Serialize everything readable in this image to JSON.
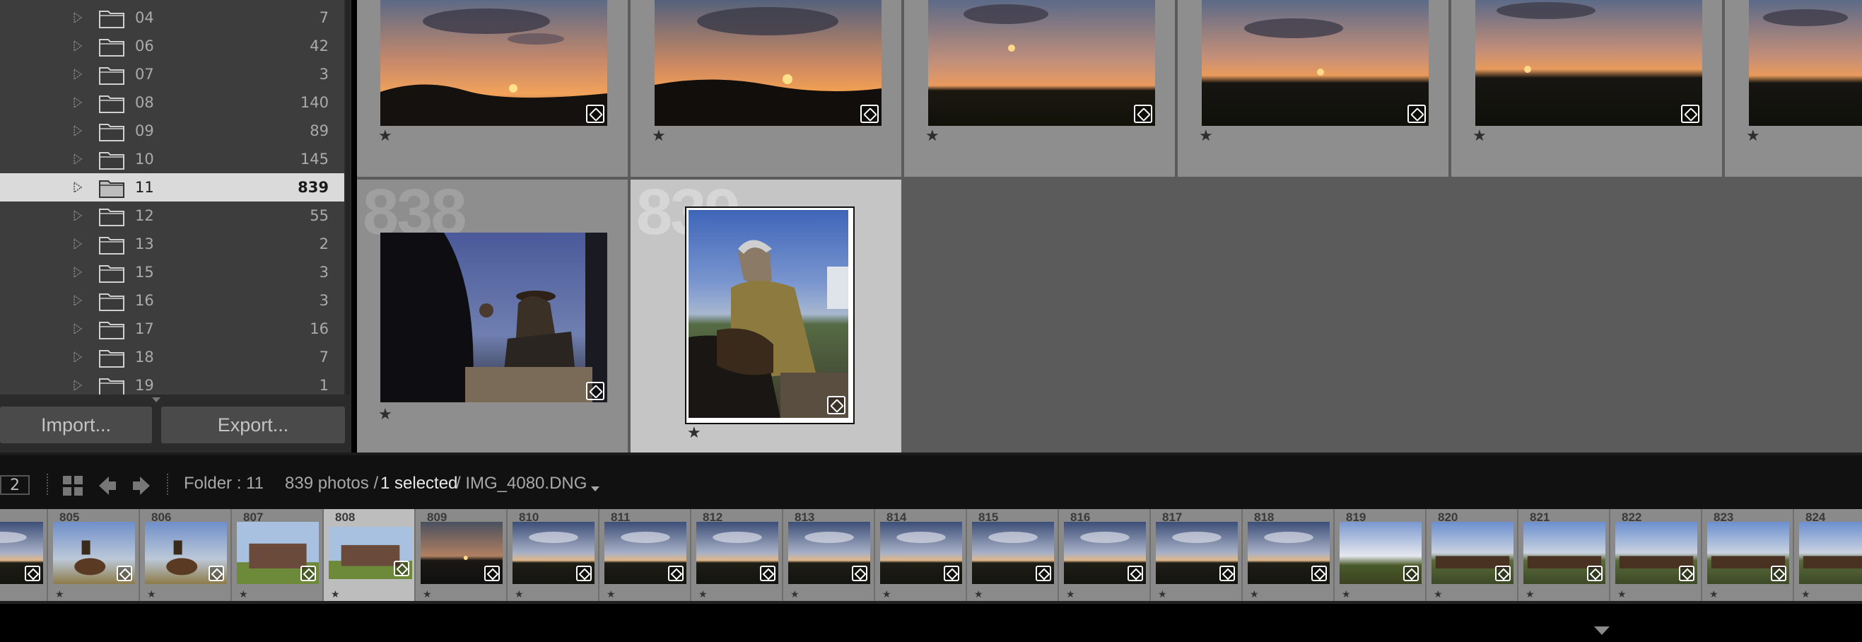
{
  "folders": [
    {
      "name": "04",
      "count": "7"
    },
    {
      "name": "06",
      "count": "42"
    },
    {
      "name": "07",
      "count": "3"
    },
    {
      "name": "08",
      "count": "140"
    },
    {
      "name": "09",
      "count": "89"
    },
    {
      "name": "10",
      "count": "145"
    },
    {
      "name": "11",
      "count": "839",
      "selected": true
    },
    {
      "name": "12",
      "count": "55"
    },
    {
      "name": "13",
      "count": "2"
    },
    {
      "name": "15",
      "count": "3"
    },
    {
      "name": "16",
      "count": "3"
    },
    {
      "name": "17",
      "count": "16"
    },
    {
      "name": "18",
      "count": "7"
    },
    {
      "name": "19",
      "count": "1"
    }
  ],
  "buttons": {
    "import": "Import...",
    "export": "Export..."
  },
  "grid": {
    "cells": [
      {
        "index": "838",
        "type": "people-dusk"
      },
      {
        "index": "839",
        "type": "man-dog",
        "selected": true
      }
    ]
  },
  "toolbar": {
    "page": "2",
    "folder": "Folder : 11",
    "photos_count": "839 photos /",
    "selected": "1 selected",
    "filename": "/ IMG_4080.DNG"
  },
  "filmstrip": [
    {
      "num": ""
    },
    {
      "num": "805",
      "type": "rider"
    },
    {
      "num": "806",
      "type": "rider"
    },
    {
      "num": "807",
      "type": "group"
    },
    {
      "num": "808",
      "type": "group",
      "selected": true
    },
    {
      "num": "809",
      "type": "sunset"
    },
    {
      "num": "810",
      "type": "sky"
    },
    {
      "num": "811",
      "type": "sky"
    },
    {
      "num": "812",
      "type": "sky"
    },
    {
      "num": "813",
      "type": "sky"
    },
    {
      "num": "814",
      "type": "sky"
    },
    {
      "num": "815",
      "type": "sky"
    },
    {
      "num": "816",
      "type": "sky"
    },
    {
      "num": "817",
      "type": "sky"
    },
    {
      "num": "818",
      "type": "sky"
    },
    {
      "num": "819",
      "type": "bright"
    },
    {
      "num": "820",
      "type": "herd"
    },
    {
      "num": "821",
      "type": "herd"
    },
    {
      "num": "822",
      "type": "herd"
    },
    {
      "num": "823",
      "type": "herd"
    },
    {
      "num": "824",
      "type": "herd"
    }
  ],
  "colors": {
    "selected_row": "#dadada",
    "grid_bg": "#5b5b5b",
    "cell": "#8e8e8e",
    "selected_cell": "#c5c5c5"
  }
}
